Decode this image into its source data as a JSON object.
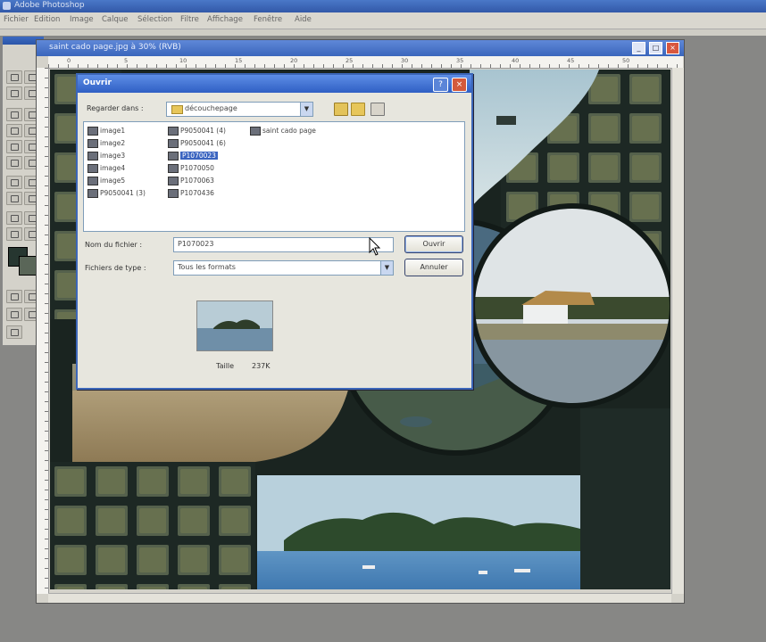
{
  "app": {
    "title": "Adobe Photoshop",
    "menu": [
      "Fichier",
      "Edition",
      "Image",
      "Calque",
      "Sélection",
      "Filtre",
      "Affichage",
      "Fenêtre",
      "Aide"
    ]
  },
  "document": {
    "title": "saint cado page.jpg à 30% (RVB)",
    "ruler_ticks": [
      "0",
      "5",
      "10",
      "15",
      "20",
      "25",
      "30",
      "35",
      "40",
      "45",
      "50",
      "55"
    ]
  },
  "dialog": {
    "title": "Ouvrir",
    "help_label": "?",
    "close_label": "×",
    "lookin_label": "Regarder dans :",
    "lookin_value": "découchepage",
    "files": [
      {
        "name": "image1"
      },
      {
        "name": "image2"
      },
      {
        "name": "image3"
      },
      {
        "name": "image4"
      },
      {
        "name": "image5"
      },
      {
        "name": "P9050041 (3)"
      },
      {
        "name": "P9050041 (4)"
      },
      {
        "name": "P9050041 (6)"
      },
      {
        "name": "P1070023",
        "selected": true
      },
      {
        "name": "P1070050"
      },
      {
        "name": "P1070063"
      },
      {
        "name": "P1070436"
      },
      {
        "name": "saint cado page"
      }
    ],
    "filename_label": "Nom du fichier :",
    "filename_value": "P1070023",
    "filetype_label": "Fichiers de type :",
    "filetype_value": "Tous les formats",
    "open_button": "Ouvrir",
    "cancel_button": "Annuler",
    "size_label": "Taille",
    "size_value": "237K"
  },
  "colors": {
    "title_blue": "#2f5fc4",
    "selection_blue": "#3a64c0",
    "close_red": "#d45a3c",
    "foreground": "#263630",
    "background": "#5a6658"
  },
  "icons": [
    "folder-icon",
    "up-folder-icon",
    "new-folder-icon",
    "view-menu-icon",
    "image-file-icon",
    "mouse-pointer-icon"
  ]
}
